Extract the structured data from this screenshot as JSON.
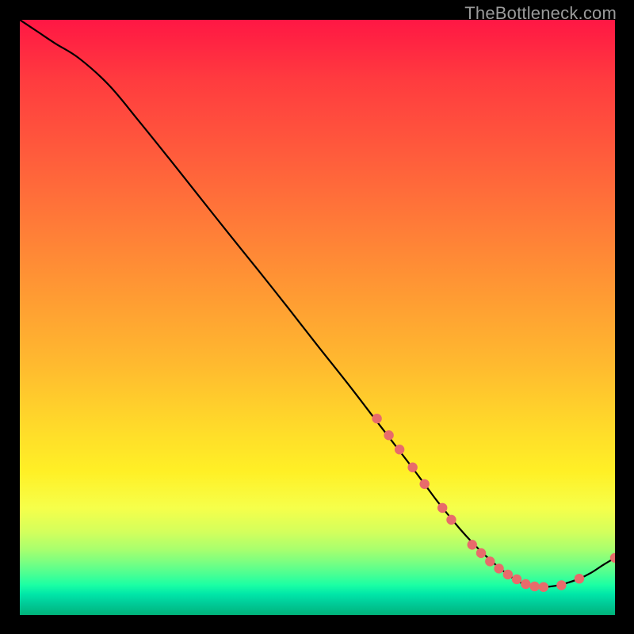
{
  "watermark": "TheBottleneck.com",
  "colors": {
    "background": "#000000",
    "curve": "#000000",
    "dot": "#e86b6b"
  },
  "chart_data": {
    "type": "line",
    "title": "",
    "xlabel": "",
    "ylabel": "",
    "xlim": [
      0,
      100
    ],
    "ylim": [
      0,
      100
    ],
    "grid": false,
    "legend": false,
    "background": "rainbow-vertical-gradient",
    "note": "bottleneck-style curve: high at left, steep drop, trough near x≈86, slight rise at right; salmon dots mark samples on the right segment",
    "series": [
      {
        "name": "curve",
        "x": [
          0,
          3,
          6,
          10,
          15,
          20,
          25,
          30,
          35,
          40,
          45,
          50,
          55,
          60,
          65,
          68,
          70,
          72,
          74,
          76,
          78,
          80,
          82,
          84,
          86,
          88,
          90,
          92,
          94,
          96,
          98,
          100
        ],
        "values": [
          100,
          98,
          96,
          93.5,
          89,
          83,
          76.8,
          70.5,
          64.2,
          58,
          51.7,
          45.3,
          39,
          32.5,
          26,
          22,
          19.3,
          16.8,
          14.4,
          12.2,
          10.2,
          8.4,
          6.8,
          5.5,
          4.8,
          4.7,
          4.9,
          5.4,
          6.1,
          7.1,
          8.4,
          9.6
        ]
      }
    ],
    "markers": [
      {
        "x": 60.0,
        "y": 33.0
      },
      {
        "x": 62.0,
        "y": 30.2
      },
      {
        "x": 63.8,
        "y": 27.8
      },
      {
        "x": 66.0,
        "y": 24.8
      },
      {
        "x": 68.0,
        "y": 22.0
      },
      {
        "x": 71.0,
        "y": 18.0
      },
      {
        "x": 72.5,
        "y": 16.0
      },
      {
        "x": 76.0,
        "y": 11.8
      },
      {
        "x": 77.5,
        "y": 10.4
      },
      {
        "x": 79.0,
        "y": 9.0
      },
      {
        "x": 80.5,
        "y": 7.8
      },
      {
        "x": 82.0,
        "y": 6.8
      },
      {
        "x": 83.5,
        "y": 6.0
      },
      {
        "x": 85.0,
        "y": 5.2
      },
      {
        "x": 86.5,
        "y": 4.8
      },
      {
        "x": 88.0,
        "y": 4.7
      },
      {
        "x": 91.0,
        "y": 5.0
      },
      {
        "x": 94.0,
        "y": 6.1
      },
      {
        "x": 100.0,
        "y": 9.6
      }
    ]
  }
}
